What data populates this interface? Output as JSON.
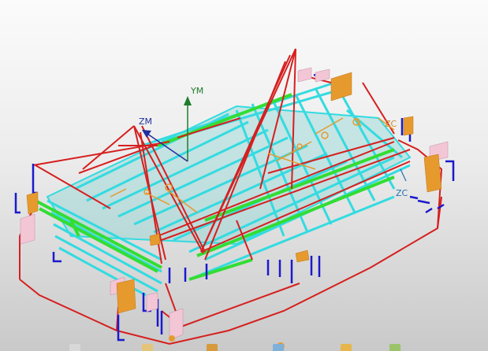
{
  "viewport": {
    "labels": {
      "ym": "YM",
      "zm": "ZM",
      "zc": "ZC",
      "zc2": "ZC"
    }
  },
  "colors": {
    "background_top": "#fbfbfb",
    "background_bottom": "#c9c9c9",
    "frame_red": "#d61f1f",
    "frame_cyan": "#33dbe0",
    "frame_green": "#33dd33",
    "frame_blue": "#1a1acc",
    "frame_orange": "#e69a2e",
    "frame_pink": "#f3c6d6",
    "axis_green": "#1e7d2b",
    "axis_blue": "#1f2f9e"
  },
  "toolbar": {
    "icons": [
      "view-icon",
      "sketch-icon",
      "shape-icon",
      "measure-icon",
      "select-icon",
      "analysis-icon"
    ]
  }
}
